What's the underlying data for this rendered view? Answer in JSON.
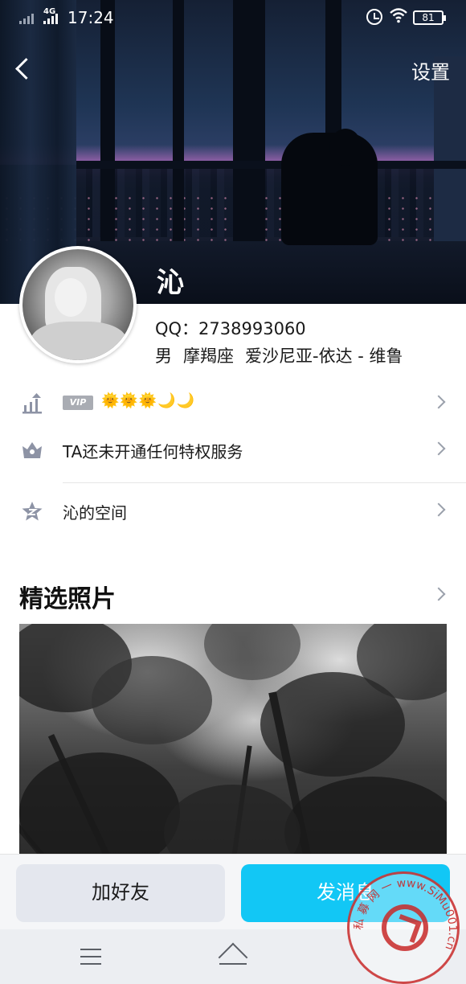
{
  "status_bar": {
    "network": "4G",
    "time": "17:24",
    "battery": "81"
  },
  "nav": {
    "settings_label": "设置"
  },
  "profile": {
    "nickname": "沁",
    "qq_line": "QQ：2738993060",
    "gender": "男",
    "zodiac": "摩羯座",
    "location": "爱沙尼亚-依达 - 维鲁"
  },
  "rows": {
    "level": {
      "vip_badge": "VIP",
      "level_icons": "🌞🌞🌞🌙🌙"
    },
    "privilege": {
      "label": "TA还未开通任何特权服务"
    },
    "space": {
      "label": "沁的空间"
    }
  },
  "photos": {
    "title": "精选照片"
  },
  "actions": {
    "add_friend": "加好友",
    "send_message": "发消息"
  },
  "watermark": {
    "text": "私 募 网 一 www.SiMu001.cn"
  },
  "colors": {
    "accent": "#12c7f5",
    "secondary_button": "#e4e7ee",
    "icon_gray": "#8d93a5"
  }
}
